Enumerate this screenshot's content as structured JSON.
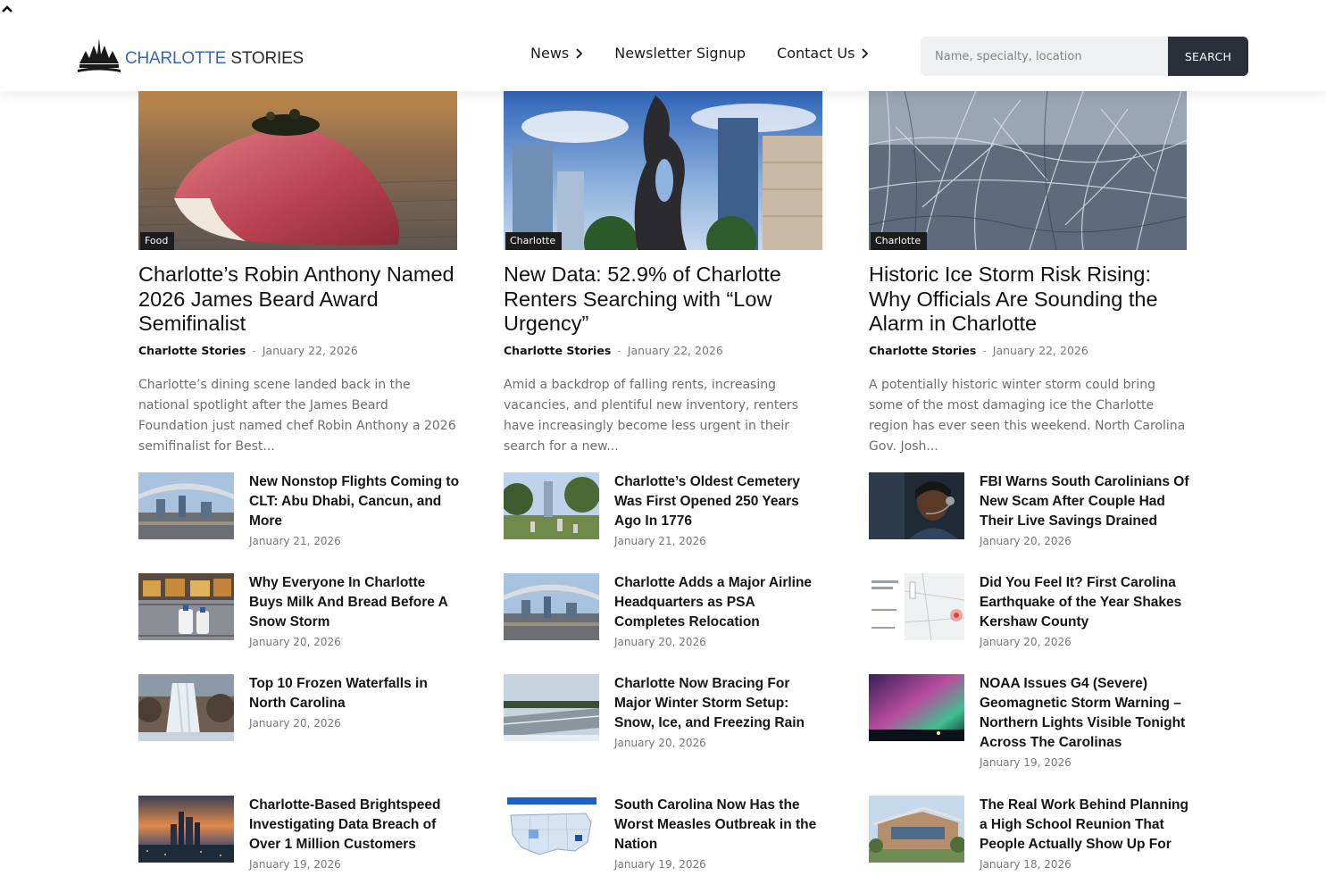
{
  "header": {
    "logo": {
      "word1": "CHARLOTTE",
      "word2": "STORIES"
    },
    "nav": [
      {
        "label": "News",
        "has_submenu": true
      },
      {
        "label": "Newsletter Signup",
        "has_submenu": false
      },
      {
        "label": "Contact Us",
        "has_submenu": true
      }
    ],
    "search": {
      "placeholder": "Name, specialty, location",
      "button_label": "SEARCH"
    }
  },
  "features": [
    {
      "category": "Food",
      "title": "Charlotte’s Robin Anthony Named 2026 James Beard Award Semifinalist",
      "author": "Charlotte Stories",
      "date": "January 22, 2026",
      "excerpt": "Charlotte’s dining scene landed back in the national spotlight after the James Beard Foundation just named chef Robin Anthony a 2026 semifinalist for Best..."
    },
    {
      "category": "Charlotte",
      "title": "New Data: 52.9% of Charlotte Renters Searching with “Low Urgency”",
      "author": "Charlotte Stories",
      "date": "January 22, 2026",
      "excerpt": "Amid a backdrop of falling rents, increasing vacancies, and plentiful new inventory, renters have increasingly become less urgent in their search for a new..."
    },
    {
      "category": "Charlotte",
      "title": "Historic Ice Storm Risk Rising: Why Officials Are Sounding the Alarm in Charlotte",
      "author": "Charlotte Stories",
      "date": "January 22, 2026",
      "excerpt": "A potentially historic winter storm could bring some of the most damaging ice the Charlotte region has ever seen this weekend. North Carolina Gov. Josh..."
    }
  ],
  "items": [
    {
      "title": "New Nonstop Flights Coming to CLT: Abu Dhabi, Cancun, and More",
      "date": "January 21, 2026"
    },
    {
      "title": "Charlotte’s Oldest Cemetery Was First Opened 250 Years Ago In 1776",
      "date": "January 21, 2026"
    },
    {
      "title": "FBI Warns South Carolinians Of New Scam After Couple Had Their Live Savings Drained",
      "date": "January 20, 2026"
    },
    {
      "title": "Why Everyone In Charlotte Buys Milk And Bread Before A Snow Storm",
      "date": "January 20, 2026"
    },
    {
      "title": "Charlotte Adds a Major Airline Headquarters as PSA Completes Relocation",
      "date": "January 20, 2026"
    },
    {
      "title": "Did You Feel It? First Carolina Earthquake of the Year Shakes Kershaw County",
      "date": "January 20, 2026"
    },
    {
      "title": "Top 10 Frozen Waterfalls in North Carolina",
      "date": "January 20, 2026"
    },
    {
      "title": "Charlotte Now Bracing For Major Winter Storm Setup: Snow, Ice, and Freezing Rain",
      "date": "January 20, 2026"
    },
    {
      "title": "NOAA Issues G4 (Severe) Geomagnetic Storm Warning – Northern Lights Visible Tonight Across The Carolinas",
      "date": "January 19, 2026"
    },
    {
      "title": "Charlotte-Based Brightspeed Investigating Data Breach of Over 1 Million Customers",
      "date": "January 19, 2026"
    },
    {
      "title": "South Carolina Now Has the Worst Measles Outbreak in the Nation",
      "date": "January 19, 2026"
    },
    {
      "title": "The Real Work Behind Planning a High School Reunion That People Actually Show Up For",
      "date": "January 18, 2026"
    }
  ]
}
